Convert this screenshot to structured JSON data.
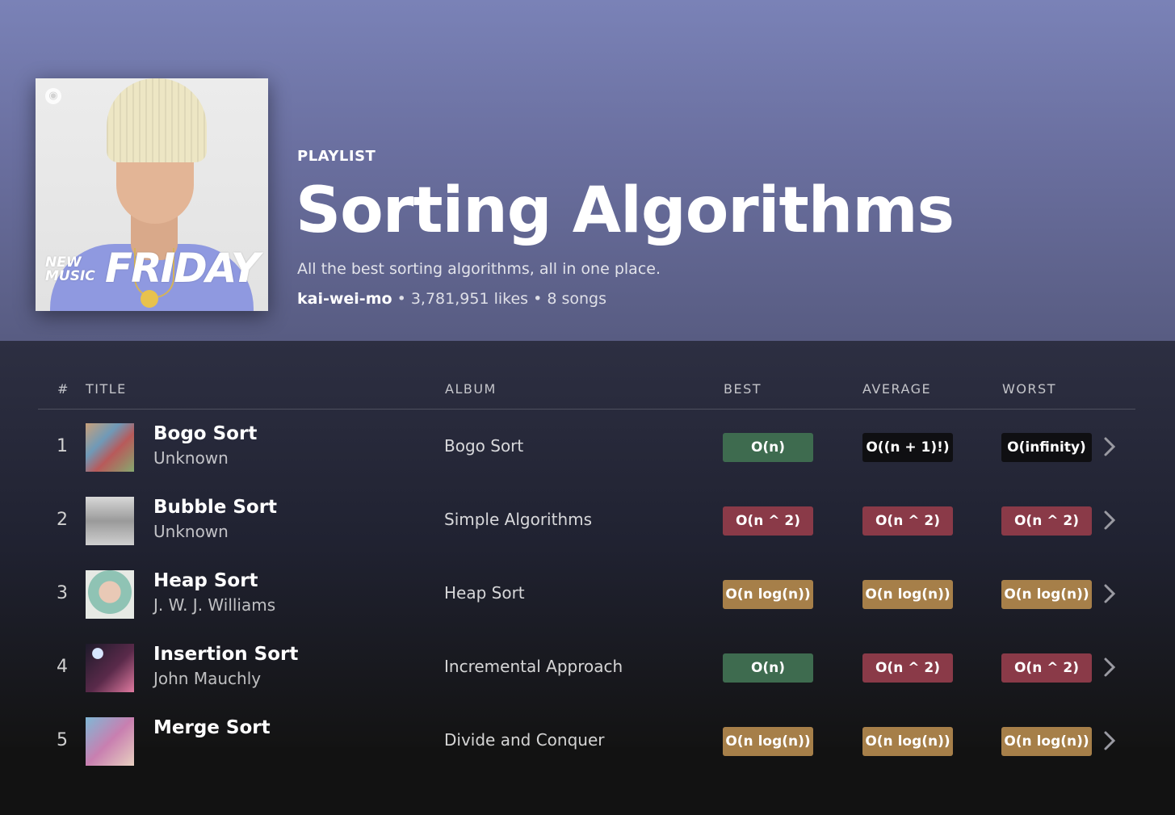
{
  "playlist": {
    "kind": "PLAYLIST",
    "title": "Sorting Algorithms",
    "description": "All the best sorting algorithms, all in one place.",
    "owner": "kai-wei-mo",
    "likes": "• 3,781,951 likes",
    "songs": "• 8 songs",
    "cover": {
      "brand_small": "NEW MUSIC",
      "brand_big": "FRIDAY",
      "shirt_color": "#8f99e0"
    }
  },
  "columns": {
    "num": "#",
    "title": "TITLE",
    "album": "ALBUM",
    "best": "BEST",
    "average": "AVERAGE",
    "worst": "WORST"
  },
  "colors": {
    "green": "#3e6b4f",
    "red": "#8a3a48",
    "gold": "#a67f49",
    "black": "#0f0f12"
  },
  "tracks": [
    {
      "num": "1",
      "title": "Bogo Sort",
      "artist": "Unknown",
      "album": "Bogo Sort",
      "best": "O(n)",
      "average": "O((n + 1)!)",
      "worst": "O(infinity)"
    },
    {
      "num": "2",
      "title": "Bubble Sort",
      "artist": "Unknown",
      "album": "Simple Algorithms",
      "best": "O(n ^ 2)",
      "average": "O(n ^ 2)",
      "worst": "O(n ^ 2)"
    },
    {
      "num": "3",
      "title": "Heap Sort",
      "artist": "J. W. J. Williams",
      "album": "Heap Sort",
      "best": "O(n log(n))",
      "average": "O(n log(n))",
      "worst": "O(n log(n))"
    },
    {
      "num": "4",
      "title": "Insertion Sort",
      "artist": "John Mauchly",
      "album": "Incremental Approach",
      "best": "O(n)",
      "average": "O(n ^ 2)",
      "worst": "O(n ^ 2)"
    },
    {
      "num": "5",
      "title": "Merge Sort",
      "artist": "",
      "album": "Divide and Conquer",
      "best": "O(n log(n))",
      "average": "O(n log(n))",
      "worst": "O(n log(n))"
    }
  ]
}
